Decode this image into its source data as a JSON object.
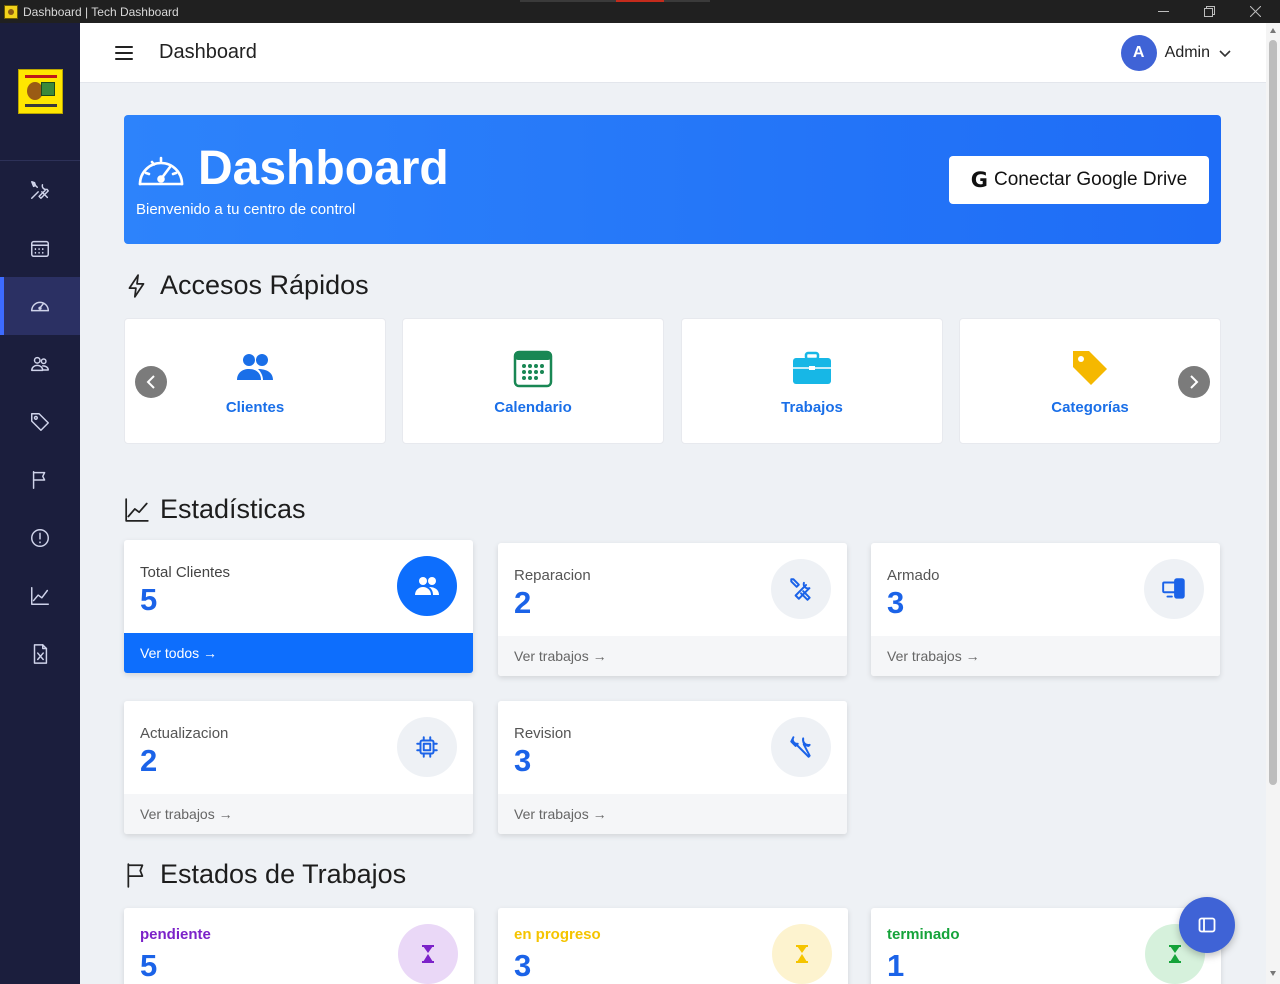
{
  "window": {
    "title": "Dashboard | Tech Dashboard"
  },
  "header": {
    "title": "Dashboard",
    "user_initial": "A",
    "user_name": "Admin"
  },
  "sidebar": {
    "items": [
      {
        "name": "tools-icon",
        "active": false
      },
      {
        "name": "calendar-icon",
        "active": false
      },
      {
        "name": "speedometer-icon",
        "active": true
      },
      {
        "name": "people-icon",
        "active": false
      },
      {
        "name": "tags-icon",
        "active": false
      },
      {
        "name": "flag-icon",
        "active": false
      },
      {
        "name": "exclamation-circle-icon",
        "active": false
      },
      {
        "name": "graph-icon",
        "active": false
      },
      {
        "name": "file-excel-icon",
        "active": false
      }
    ]
  },
  "hero": {
    "title": "Dashboard",
    "subtitle": "Bienvenido a tu centro de control",
    "drive_button": "Conectar Google Drive",
    "drive_button_icon": "G"
  },
  "quick_access": {
    "title": "Accesos Rápidos",
    "items": [
      {
        "label": "Clientes",
        "icon": "people-icon",
        "color": "#1a6fe8"
      },
      {
        "label": "Calendario",
        "icon": "calendar-icon",
        "color": "#198754"
      },
      {
        "label": "Trabajos",
        "icon": "briefcase-icon",
        "color": "#17b7e6"
      },
      {
        "label": "Categorías",
        "icon": "tag-icon",
        "color": "#f5b800"
      }
    ]
  },
  "stats": {
    "title": "Estadísticas",
    "cards": [
      {
        "label": "Total Clientes",
        "value": "5",
        "link": "Ver todos →",
        "icon": "people-icon"
      },
      {
        "label": "Reparacion",
        "value": "2",
        "link": "Ver trabajos →",
        "icon": "tools-icon"
      },
      {
        "label": "Armado",
        "value": "3",
        "link": "Ver trabajos →",
        "icon": "devices-icon"
      },
      {
        "label": "Actualizacion",
        "value": "2",
        "link": "Ver trabajos →",
        "icon": "cpu-icon"
      },
      {
        "label": "Revision",
        "value": "3",
        "link": "Ver trabajos →",
        "icon": "wrench-icon"
      }
    ]
  },
  "job_states": {
    "title": "Estados de Trabajos",
    "cards": [
      {
        "label": "pendiente",
        "value": "5",
        "label_color": "#7c22c9",
        "icon_bg": "#ead8f7",
        "icon_color": "#7c22c9",
        "icon": "hourglass-icon"
      },
      {
        "label": "en progreso",
        "value": "3",
        "label_color": "#f5c400",
        "icon_bg": "#fdf3cf",
        "icon_color": "#f5c400",
        "icon": "hourglass-icon"
      },
      {
        "label": "terminado",
        "value": "1",
        "label_color": "#15a33a",
        "icon_bg": "#d6f1dc",
        "icon_color": "#15a33a",
        "icon": "hourglass-icon"
      }
    ]
  }
}
